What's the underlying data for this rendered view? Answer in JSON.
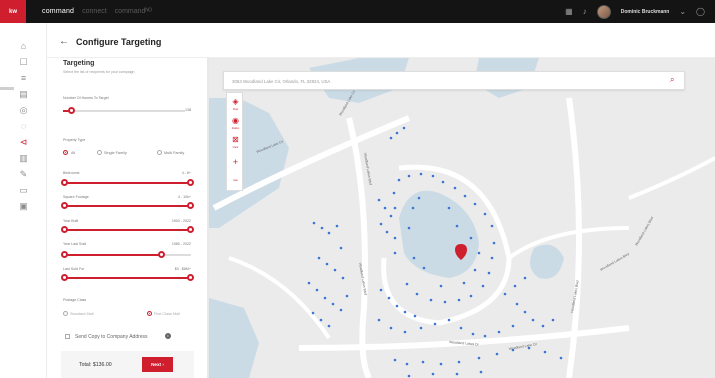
{
  "topbar": {
    "logo": "kw",
    "nav": [
      "command",
      "connect",
      "commandᴺᴼ"
    ],
    "user_name": "Dominic Bruckmann",
    "icons": [
      "grid-icon",
      "bell-icon",
      "help-icon"
    ]
  },
  "header": {
    "back_glyph": "←",
    "title": "Configure Targeting"
  },
  "panel": {
    "title": "Targeting",
    "subtitle": "Select the list of recipients for your campaign",
    "sliders": [
      {
        "label": "Number Of Homes To Target",
        "value": "138",
        "fraction_low": 0.08,
        "fraction_high": 1.0
      },
      {
        "label": "Bedrooms",
        "value": "4 - 8+",
        "fraction_low": 0.0,
        "fraction_high": 1.0
      },
      {
        "label": "Square Footage",
        "value": "4 - 10k+",
        "fraction_low": 0.0,
        "fraction_high": 1.0
      },
      {
        "label": "Year Built",
        "value": "1900 - 2022",
        "fraction_low": 0.0,
        "fraction_high": 1.0
      },
      {
        "label": "Year Last Sold",
        "value": "1985 - 2022",
        "fraction_low": 0.0,
        "fraction_high": 0.75
      },
      {
        "label": "Last Sold For",
        "value": "$0 - $8M+",
        "fraction_low": 0.0,
        "fraction_high": 1.0
      }
    ],
    "property_type": {
      "label": "Property Type",
      "options": [
        "All",
        "Single Family",
        "Multi Family"
      ],
      "selected": "All"
    },
    "postage": {
      "label": "Postage Class",
      "options": [
        "Standard Mail",
        "First Class Mail"
      ],
      "selected": "First Class Mail"
    },
    "send_copy": "Send Copy to Company Address",
    "total": "Total: $136.00",
    "next": "Next ›"
  },
  "map": {
    "search_text": "3063 Woodland Lake Cir, Orlando, FL 32824, USA",
    "tools": [
      {
        "icon": "polygon-draw-icon",
        "label": "Draw"
      },
      {
        "icon": "radius-icon",
        "label": "Radius"
      },
      {
        "icon": "clear-icon",
        "label": "Clear"
      }
    ],
    "streets": [
      "Woodland Lake Cir",
      "Woodland Lake Cir",
      "Woodland Lakes Blvd",
      "Woodland Lakes Blvd",
      "Woodland Lakes Dr",
      "Woodland Lake Cir",
      "Woodland Lakes Blvd",
      "Woodland Lakes Blvd",
      "Woodland Lakes Blvd"
    ],
    "colors": {
      "accent": "#cf1f2e",
      "dots": "#3a76d6",
      "water": "#cbdbe6",
      "land": "#ebebeb"
    }
  }
}
